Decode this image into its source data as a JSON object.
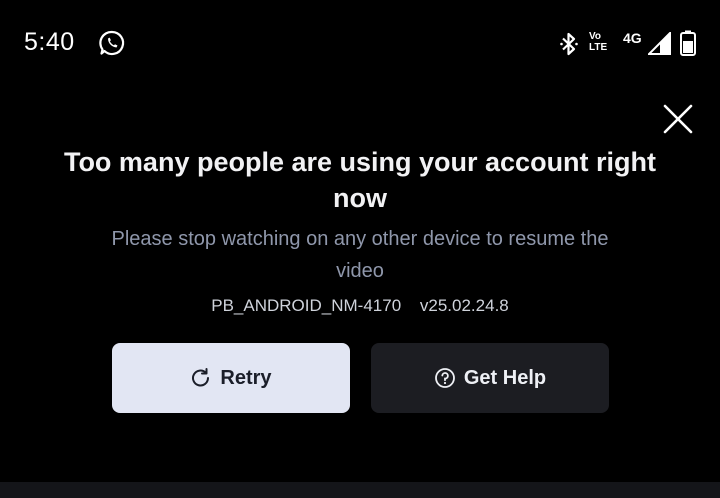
{
  "status_bar": {
    "time": "5:40",
    "volte_top": "Vo",
    "volte_bottom": "LTE",
    "network_type": "4G",
    "icons": [
      "whatsapp-icon",
      "bluetooth-icon",
      "volte-icon",
      "signal-icon",
      "battery-icon"
    ]
  },
  "dialog": {
    "title": "Too many people are using your account right now",
    "message": "Please stop watching on any other device to resume the video",
    "error_code": "PB_ANDROID_NM-4170",
    "version": "v25.02.24.8",
    "retry_label": "Retry",
    "help_label": "Get Help",
    "close_icon": "close-icon",
    "retry_icon": "refresh-icon",
    "help_icon": "help-circle-icon"
  },
  "colors": {
    "background": "#000000",
    "subtitle": "#8f97ab",
    "retry_bg": "#e2e6f3",
    "help_bg": "#1c1d22"
  }
}
